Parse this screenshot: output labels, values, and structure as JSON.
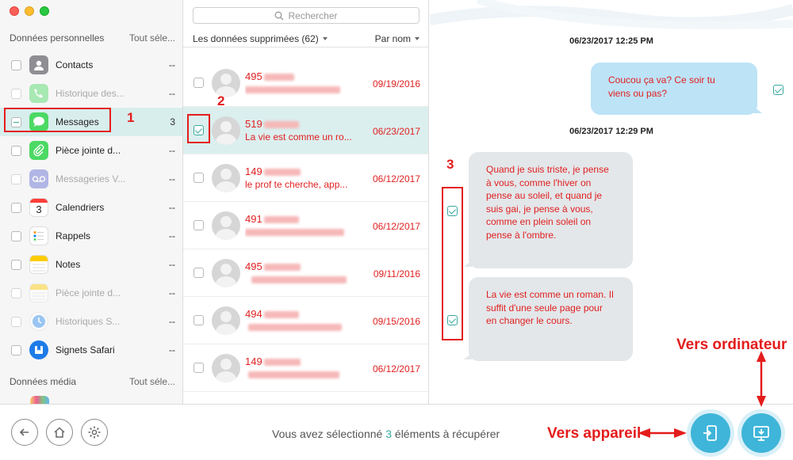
{
  "sidebar": {
    "personal_header": "Données personnelles",
    "personal_select_all": "Tout séle...",
    "media_header": "Données média",
    "media_select_all": "Tout séle...",
    "items": [
      {
        "label": "Contacts",
        "count": "--",
        "icon": "contacts-icon"
      },
      {
        "label": "Historique des...",
        "count": "--",
        "icon": "phone-icon"
      },
      {
        "label": "Messages",
        "count": "3",
        "icon": "messages-icon"
      },
      {
        "label": "Pièce jointe d...",
        "count": "--",
        "icon": "paperclip-icon"
      },
      {
        "label": "Messageries V...",
        "count": "--",
        "icon": "voicemail-icon"
      },
      {
        "label": "Calendriers",
        "count": "--",
        "icon": "calendar-icon",
        "day": "3"
      },
      {
        "label": "Rappels",
        "count": "--",
        "icon": "reminders-icon"
      },
      {
        "label": "Notes",
        "count": "--",
        "icon": "notes-icon"
      },
      {
        "label": "Pièce jointe d...",
        "count": "--",
        "icon": "note-attachment-icon"
      },
      {
        "label": "Historiques S...",
        "count": "--",
        "icon": "safari-history-icon"
      },
      {
        "label": "Signets Safari",
        "count": "--",
        "icon": "safari-bookmarks-icon"
      }
    ]
  },
  "list": {
    "search_placeholder": "Rechercher",
    "filter_label": "Les données supprimées (62)",
    "sort_label": "Par nom",
    "rows": [
      {
        "number": "495",
        "preview": "",
        "date": "09/19/2016"
      },
      {
        "number": "519",
        "preview": "La vie est comme un ro...",
        "date": "06/23/2017"
      },
      {
        "number": "149",
        "preview": "le prof te cherche, app...",
        "date": "06/12/2017"
      },
      {
        "number": "491",
        "preview": "",
        "date": "06/12/2017"
      },
      {
        "number": "495",
        "preview": "",
        "date": "09/11/2016"
      },
      {
        "number": "494",
        "preview": "",
        "date": "09/15/2016"
      },
      {
        "number": "149",
        "preview": "",
        "date": "06/12/2017"
      }
    ]
  },
  "chat": {
    "timestamp_1": "06/23/2017 12:25 PM",
    "timestamp_2": "06/23/2017 12:29 PM",
    "bubble_out": "Coucou ça va? Ce soir tu viens ou pas?",
    "bubble_in_1": "Quand je suis triste, je pense à vous, comme l'hiver on pense au soleil, et quand je suis gai, je pense à vous, comme en plein soleil on pense à l'ombre.",
    "bubble_in_2": "La vie est comme un roman. Il suffit d'une seule page pour en changer le cours."
  },
  "bottom": {
    "status_prefix": "Vous avez sélectionné ",
    "status_count": "3",
    "status_suffix": " éléments à récupérer"
  },
  "annotations": {
    "step_1": "1",
    "step_2": "2",
    "step_3": "3",
    "to_computer": "Vers ordinateur",
    "to_device": "Vers appareil"
  },
  "colors": {
    "accent": "#3aa8a0",
    "annotation": "#e41c1c",
    "message_text": "#e02020",
    "recover_button": "#3fb5d9"
  }
}
